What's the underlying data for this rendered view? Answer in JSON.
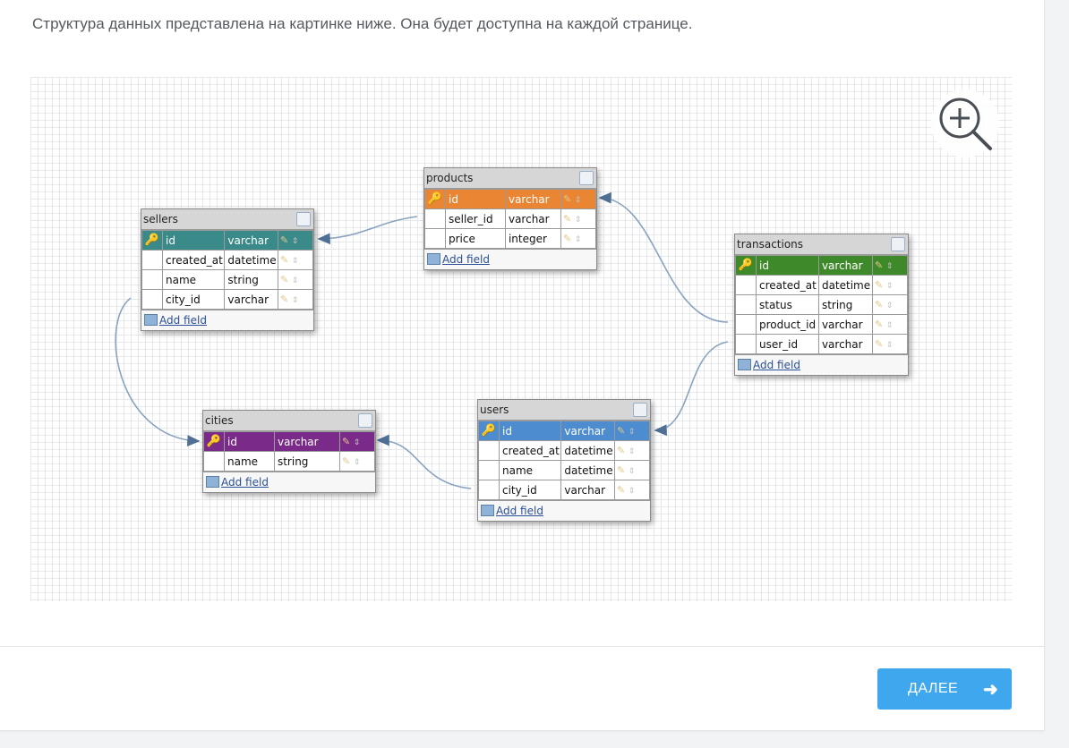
{
  "intro_text": "Структура данных представлена на картинке ниже. Она будет доступна на каждой странице.",
  "next_button": {
    "label": "ДАЛЕЕ",
    "icon": "arrow-right-icon"
  },
  "zoom_icon": "zoom-in-icon",
  "add_field_label": "Add field",
  "tables": {
    "sellers": {
      "title": "sellers",
      "header_color": "#3a8a8a",
      "fields": [
        {
          "name": "id",
          "type": "varchar",
          "primary": true
        },
        {
          "name": "created_at",
          "type": "datetime"
        },
        {
          "name": "name",
          "type": "string"
        },
        {
          "name": "city_id",
          "type": "varchar"
        }
      ]
    },
    "products": {
      "title": "products",
      "header_color": "#ea8534",
      "fields": [
        {
          "name": "id",
          "type": "varchar",
          "primary": true
        },
        {
          "name": "seller_id",
          "type": "varchar"
        },
        {
          "name": "price",
          "type": "integer"
        }
      ]
    },
    "transactions": {
      "title": "transactions",
      "header_color": "#3e8a2a",
      "fields": [
        {
          "name": "id",
          "type": "varchar",
          "primary": true
        },
        {
          "name": "created_at",
          "type": "datetime"
        },
        {
          "name": "status",
          "type": "string"
        },
        {
          "name": "product_id",
          "type": "varchar"
        },
        {
          "name": "user_id",
          "type": "varchar"
        }
      ]
    },
    "cities": {
      "title": "cities",
      "header_color": "#7a2a88",
      "fields": [
        {
          "name": "id",
          "type": "varchar",
          "primary": true
        },
        {
          "name": "name",
          "type": "string"
        }
      ]
    },
    "users": {
      "title": "users",
      "header_color": "#4c8ccf",
      "fields": [
        {
          "name": "id",
          "type": "varchar",
          "primary": true
        },
        {
          "name": "created_at",
          "type": "datetime"
        },
        {
          "name": "name",
          "type": "datetime"
        },
        {
          "name": "city_id",
          "type": "varchar"
        }
      ]
    }
  }
}
